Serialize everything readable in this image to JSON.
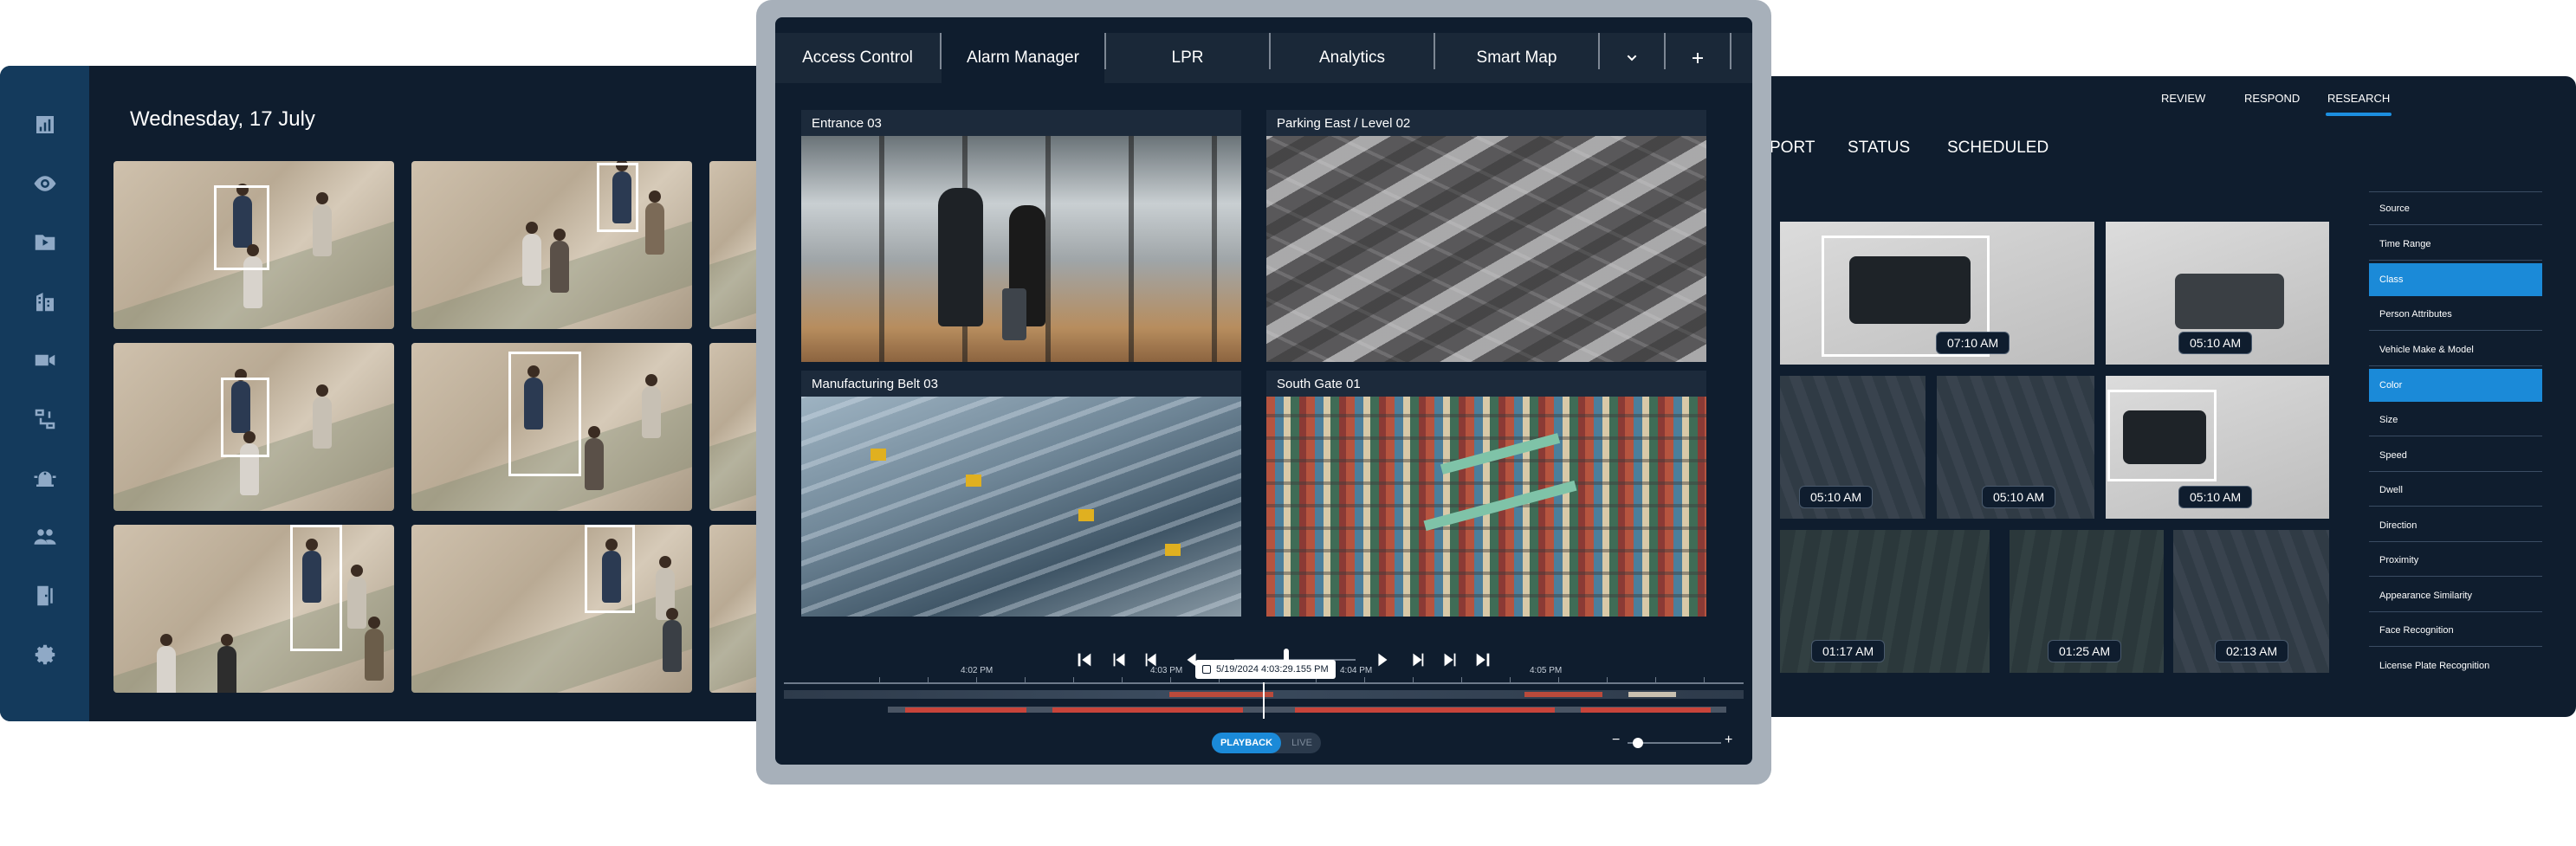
{
  "left": {
    "date": "Wednesday, 17 July",
    "nav_icons": [
      "chart-icon",
      "eye-icon",
      "video-folder-icon",
      "building-icon",
      "camera-icon",
      "workflow-icon",
      "alarm-light-icon",
      "users-icon",
      "door-access-icon",
      "gear-icon"
    ]
  },
  "center": {
    "tabs": [
      "Access Control",
      "Alarm Manager",
      "LPR",
      "Analytics",
      "Smart Map"
    ],
    "active_tab": "Alarm Manager",
    "cameras": [
      "Entrance 03",
      "Parking East / Level 02",
      "Manufacturing Belt 03",
      "South Gate 01"
    ],
    "timeline": {
      "labels": [
        "4:02 PM",
        "4:03 PM",
        "4:04 PM",
        "4:05 PM"
      ],
      "current": "5/19/2024  4:03:29.155 PM"
    },
    "mode": {
      "playback": "PLAYBACK",
      "live": "LIVE",
      "active": "PLAYBACK"
    },
    "zoom": {
      "minus": "−",
      "plus": "+"
    }
  },
  "right": {
    "top_nav": [
      "REVIEW",
      "RESPOND",
      "RESEARCH"
    ],
    "active_top": "RESEARCH",
    "tabs": [
      "PORT",
      "STATUS",
      "SCHEDULED"
    ],
    "filters": [
      "Source",
      "Time Range",
      "Class",
      "Person Attributes",
      "Vehicle Make & Model",
      "Color",
      "Size",
      "Speed",
      "Dwell",
      "Direction",
      "Proximity",
      "Appearance Similarity",
      "Face Recognition",
      "License Plate Recognition"
    ],
    "active_filters": [
      "Class",
      "Color"
    ],
    "results": [
      {
        "time": "07:10 AM"
      },
      {
        "time": "05:10 AM"
      },
      {
        "time": "05:10 AM"
      },
      {
        "time": "05:10 AM"
      },
      {
        "time": "05:10 AM"
      },
      {
        "time": "01:17 AM"
      },
      {
        "time": "01:25 AM"
      },
      {
        "time": "02:13 AM"
      }
    ]
  }
}
